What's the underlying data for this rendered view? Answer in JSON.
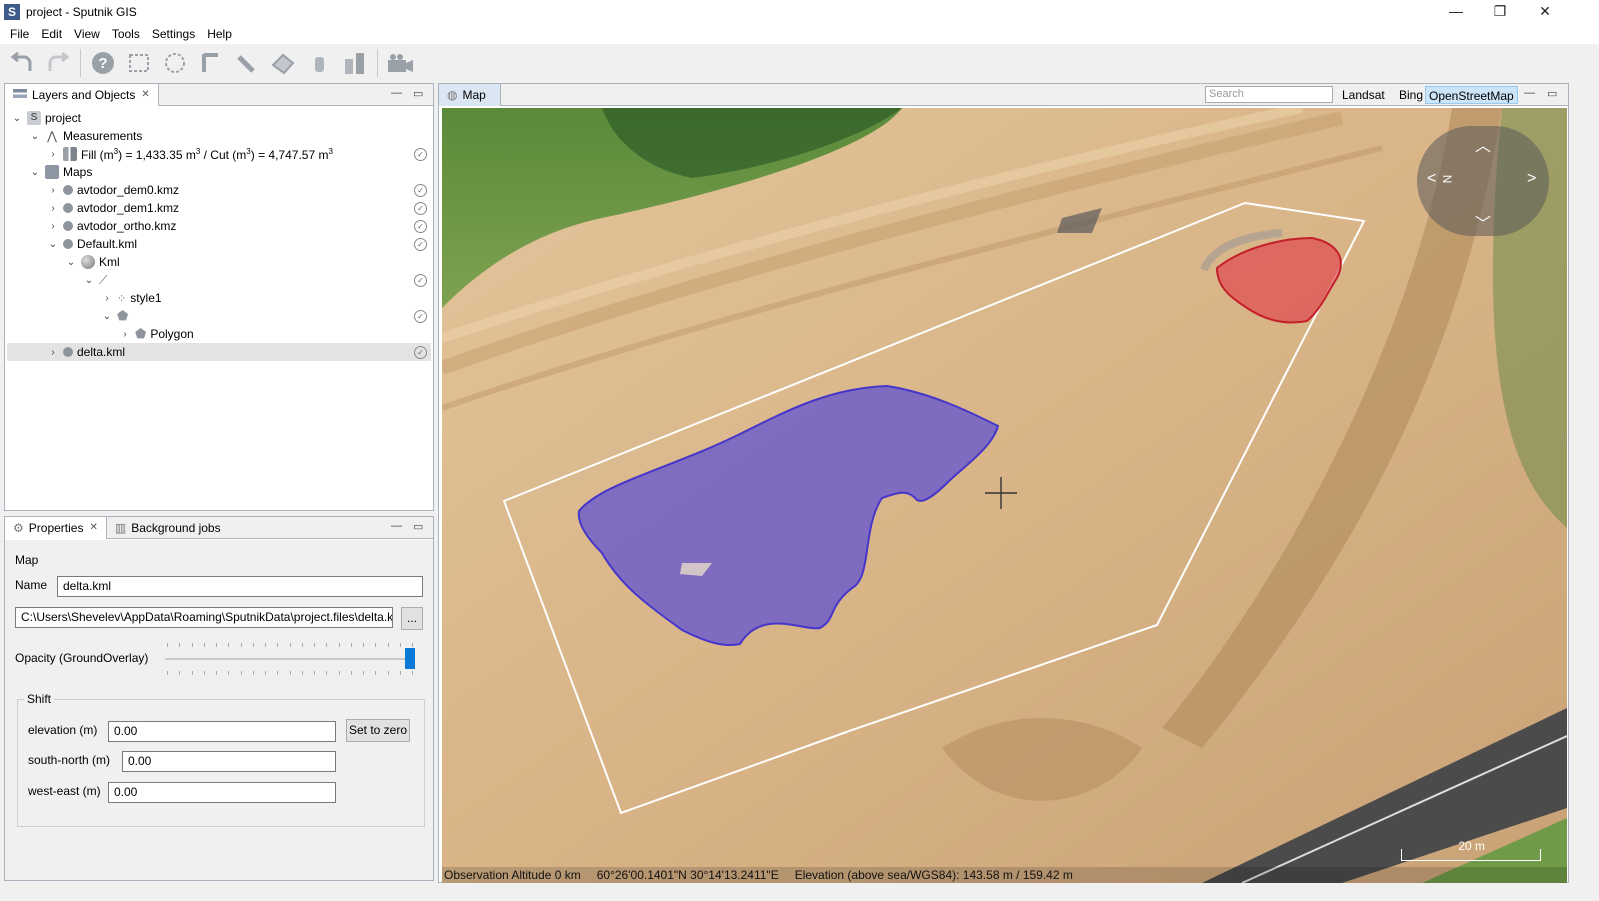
{
  "window": {
    "title": "project - Sputnik GIS",
    "icon_letter": "S",
    "controls": [
      "—",
      "❐",
      "✕"
    ]
  },
  "menu": [
    "File",
    "Edit",
    "View",
    "Tools",
    "Settings",
    "Help"
  ],
  "toolbar": {
    "icons": [
      "undo-icon",
      "redo-icon",
      "help-icon",
      "rect-select-icon",
      "lasso-select-icon",
      "ruler-angle-icon",
      "ruler-icon",
      "area-icon",
      "cylinder-icon",
      "volume-icon",
      "camera-icon"
    ]
  },
  "layers_panel": {
    "tab_label": "Layers and Objects",
    "tree": {
      "project": "project",
      "measurements": "Measurements",
      "measurement_item_prefix": "Fill (m",
      "measurement_item_mid": ") = 1,433.35 m",
      "measurement_item_mid2": " / Cut (m",
      "measurement_item_end": ") = 4,747.57 m",
      "superscript": "3",
      "maps": "Maps",
      "map1": "avtodor_dem0.kmz",
      "map2": "avtodor_dem1.kmz",
      "map3": "avtodor_ortho.kmz",
      "map4": "Default.kml",
      "kml": "Kml",
      "style1": "style1",
      "polygon": "Polygon",
      "map5": "delta.kml"
    }
  },
  "props_panel": {
    "tab_properties": "Properties",
    "tab_jobs": "Background jobs",
    "section": "Map",
    "name_label": "Name",
    "name_value": "delta.kml",
    "path_value": "C:\\Users\\Shevelev\\AppData\\Roaming\\SputnikData\\project.files\\delta.kı",
    "browse_label": "...",
    "opacity_label": "Opacity (GroundOverlay)",
    "opacity_level": 1.0,
    "shift_label": "Shift",
    "elevation_label": "elevation (m)",
    "elevation_value": "0.00",
    "set_zero_label": "Set to zero",
    "south_north_label": "south-north (m)",
    "south_north_value": "0.00",
    "west_east_label": "west-east (m)",
    "west_east_value": "0.00"
  },
  "map_panel": {
    "tab_label": "Map",
    "search_placeholder": "Search",
    "basemaps": [
      "Landsat",
      "Bing",
      "OpenStreetMap"
    ],
    "active_basemap": "OpenStreetMap",
    "status": {
      "altitude": "Observation Altitude 0 km",
      "coords": "60°26'00.1401\"N 30°14'13.2411\"E",
      "elevation": "Elevation (above sea/WGS84): 143.58 m / 159.42 m"
    },
    "scale_label": "20 m",
    "compass_letter": "N"
  },
  "colors": {
    "fill_region": "#5b4fd6",
    "cut_region": "#e0494f",
    "sand": "#d9b58a",
    "grass": "#5f8a3b"
  }
}
